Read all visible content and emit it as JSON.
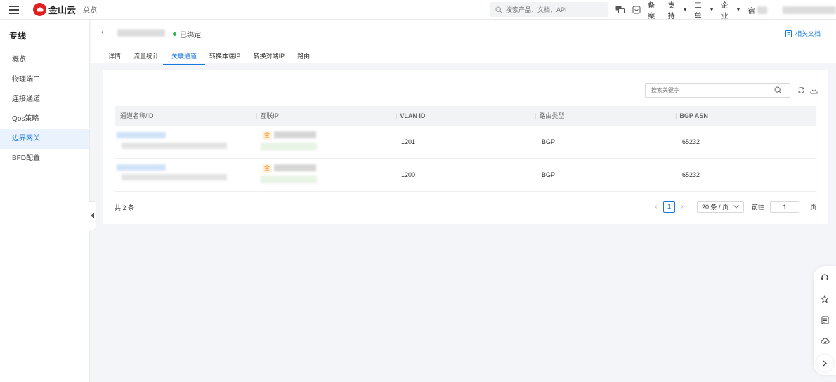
{
  "topbar": {
    "brand": "金山云",
    "overview_link": "总览",
    "search_placeholder": "搜索产品、文档、API",
    "nav": {
      "filing": "备案",
      "support": "支持",
      "ticket": "工单",
      "enterprise": "企业"
    },
    "user_initial": "宿"
  },
  "sidebar": {
    "title": "专线",
    "items": [
      {
        "label": "概览"
      },
      {
        "label": "物理端口"
      },
      {
        "label": "连接通道"
      },
      {
        "label": "Qos策略"
      },
      {
        "label": "边界网关"
      },
      {
        "label": "BFD配置"
      }
    ]
  },
  "header": {
    "status": "已绑定",
    "doc_link": "相关文档",
    "tabs": [
      {
        "label": "详情"
      },
      {
        "label": "流量统计"
      },
      {
        "label": "关联通道"
      },
      {
        "label": "转换本端IP"
      },
      {
        "label": "转换对端IP"
      },
      {
        "label": "路由"
      }
    ]
  },
  "card": {
    "search_placeholder": "搜索关键字",
    "table": {
      "columns": [
        "通道名称/ID",
        "互联IP",
        "VLAN ID",
        "路由类型",
        "BGP ASN"
      ],
      "rows": [
        {
          "vlan_id": "1201",
          "route_type": "BGP",
          "bgp_asn": "65232",
          "ip_badge": "金"
        },
        {
          "vlan_id": "1200",
          "route_type": "BGP",
          "bgp_asn": "65232",
          "ip_badge": "金"
        }
      ]
    },
    "footer": {
      "total": "共 2 条",
      "current_page": "1",
      "page_size": "20 条 / 页",
      "goto_label": "前往",
      "goto_value": "1",
      "page_unit": "页"
    }
  },
  "colors": {
    "accent": "#1677dc",
    "brand": "#e02020",
    "status_ok": "#2bb34a"
  }
}
